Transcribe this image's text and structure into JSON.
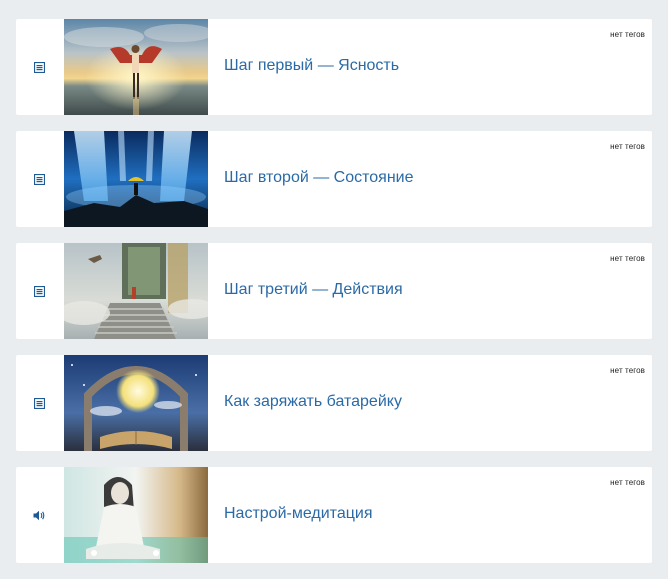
{
  "lessons": [
    {
      "title": "Шаг первый — Ясность",
      "tag": "нет тегов",
      "type_icon": "document-icon"
    },
    {
      "title": "Шаг второй — Состояние",
      "tag": "нет тегов",
      "type_icon": "document-icon"
    },
    {
      "title": "Шаг третий — Действия",
      "tag": "нет тегов",
      "type_icon": "document-icon"
    },
    {
      "title": "Как заряжать батарейку",
      "tag": "нет тегов",
      "type_icon": "document-icon"
    },
    {
      "title": "Настрой-медитация",
      "tag": "нет тегов",
      "type_icon": "audio-icon"
    }
  ],
  "colors": {
    "background": "#e9edf0",
    "card": "#ffffff",
    "link": "#2a6aa6",
    "icon": "#1f5a94"
  }
}
